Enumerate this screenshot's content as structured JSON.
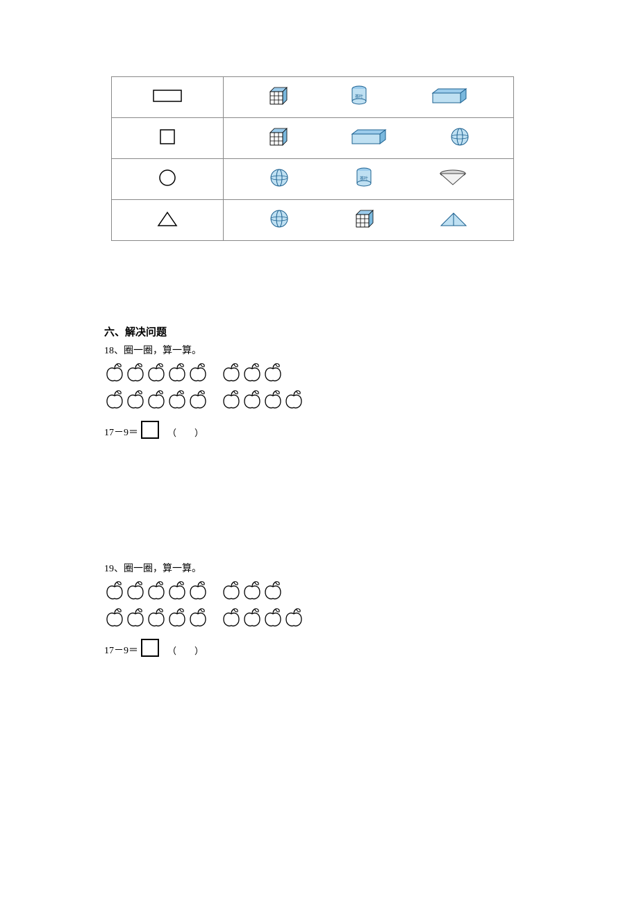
{
  "table_rows": [
    {
      "left_shape": "rectangle",
      "options": [
        "cube",
        "cylinder",
        "cuboid"
      ]
    },
    {
      "left_shape": "square",
      "options": [
        "cube",
        "cuboid",
        "sphere"
      ]
    },
    {
      "left_shape": "circle",
      "options": [
        "sphere",
        "cylinder",
        "cone"
      ]
    },
    {
      "left_shape": "triangle",
      "options": [
        "sphere",
        "cube",
        "triangle3d"
      ]
    }
  ],
  "section_title": "六、解决问题",
  "questions": [
    {
      "number": "18",
      "prompt": "圈一圈，算一算。",
      "apple_rows": [
        {
          "group1_count": 5,
          "group2_count": 3
        },
        {
          "group1_count": 5,
          "group2_count": 4
        }
      ],
      "equation": "17－9＝",
      "paren": "（　　）"
    },
    {
      "number": "19",
      "prompt": "圈一圈，算一算。",
      "apple_rows": [
        {
          "group1_count": 5,
          "group2_count": 3
        },
        {
          "group1_count": 5,
          "group2_count": 4
        }
      ],
      "equation": "17－9＝",
      "paren": "（　　）"
    }
  ]
}
